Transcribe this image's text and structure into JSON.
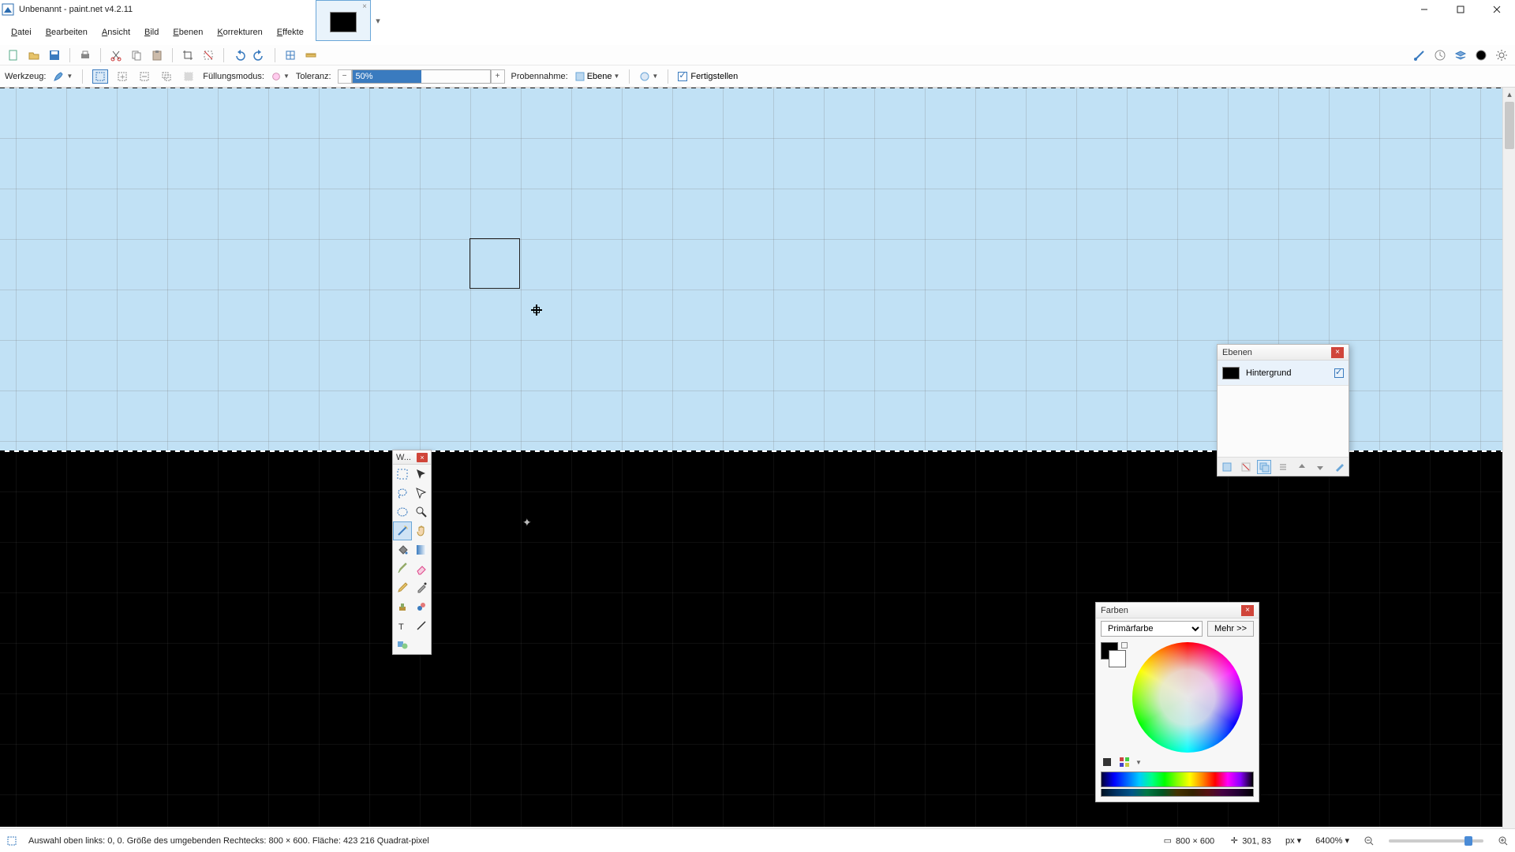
{
  "window": {
    "title": "Unbenannt - paint.net v4.2.11"
  },
  "menu": {
    "items": [
      "Datei",
      "Bearbeiten",
      "Ansicht",
      "Bild",
      "Ebenen",
      "Korrekturen",
      "Effekte"
    ]
  },
  "toolbar2": {
    "tool_label": "Werkzeug:",
    "fill_mode_label": "Füllungsmodus:",
    "tolerance_label": "Toleranz:",
    "tolerance_value": "50%",
    "tolerance_percent": 50,
    "sample_label": "Probennahme:",
    "sample_value": "Ebene",
    "finish_label": "Fertigstellen"
  },
  "toolbox": {
    "title": "W...",
    "tools": [
      "rectangle-select",
      "move-selected-pixels",
      "lasso-select",
      "move-selection",
      "ellipse-select",
      "zoom",
      "magic-wand",
      "pan",
      "paint-bucket",
      "gradient",
      "pencil",
      "eraser",
      "brush",
      "color-picker",
      "clone-stamp",
      "recolor",
      "text",
      "line-curve",
      "shapes",
      ""
    ],
    "active_index": 6
  },
  "layers_panel": {
    "title": "Ebenen",
    "rows": [
      {
        "name": "Hintergrund",
        "visible": true
      }
    ]
  },
  "colors_panel": {
    "title": "Farben",
    "mode_label": "Primärfarbe",
    "more_label": "Mehr >>"
  },
  "status": {
    "left": "Auswahl oben links: 0, 0. Größe des umgebenden Rechtecks: 800 × 600. Fläche: 423 216 Quadrat-pixel",
    "doc_size": "800 × 600",
    "cursor_pos": "301, 83",
    "unit": "px",
    "zoom": "6400%"
  }
}
